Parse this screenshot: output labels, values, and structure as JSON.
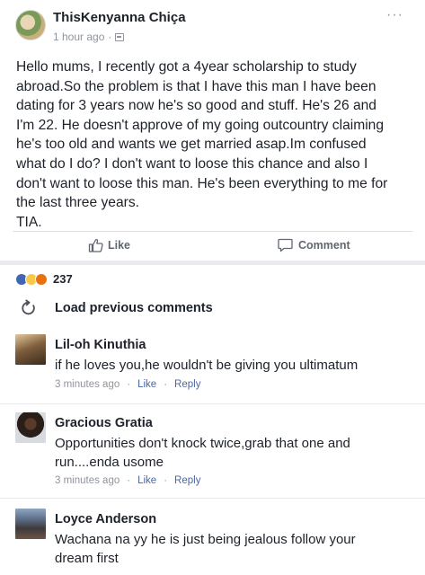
{
  "post": {
    "author": "ThisKenyanna Chiça",
    "timestamp": "1 hour ago",
    "privacy_icon": "public-globe-icon",
    "more_icon": "more-options-icon",
    "text_lines": [
      "Hello mums, I recently got a 4year scholarship to study",
      "abroad.So the problem is that I have this man I have been",
      "dating for 3 years now he's so good and stuff. He's 26 and",
      "I'm 22. He doesn't approve of my going outcountry claiming",
      "he's too old and wants we get married asap.Im confused",
      "what do I do? I don't want to loose this chance and also I",
      "don't want to loose this man. He's been everything to me for",
      "the last three years.",
      "TIA."
    ]
  },
  "actions": {
    "like": "Like",
    "comment": "Comment"
  },
  "reactions": {
    "count": "237",
    "types": [
      "like",
      "haha",
      "angry"
    ]
  },
  "load_previous": "Load previous comments",
  "comments": [
    {
      "name": "Lil-oh Kinuthia",
      "lines": [
        "if he loves you,he wouldn't be giving you ultimatum"
      ],
      "time": "3 minutes ago",
      "like": "Like",
      "reply": "Reply"
    },
    {
      "name": "Gracious Gratia",
      "lines": [
        "Opportunities don't knock twice,grab that one and",
        "run....enda usome"
      ],
      "time": "3 minutes ago",
      "like": "Like",
      "reply": "Reply"
    },
    {
      "name": "Loyce Anderson",
      "lines": [
        "Wachana na yy he is just being jealous follow your",
        "dream first"
      ]
    }
  ],
  "colors": {
    "text": "#1d2129",
    "muted": "#90949c",
    "link": "#4b67a1",
    "like_blue": "#4267b2",
    "separator": "#e9ebee"
  }
}
